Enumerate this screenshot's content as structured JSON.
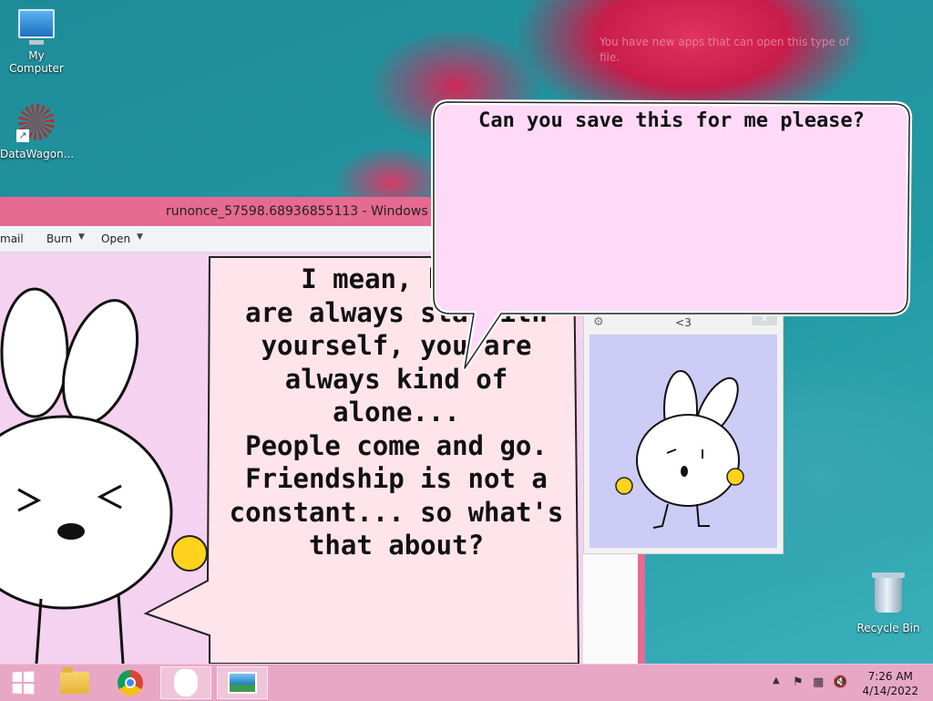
{
  "wallpaper": {
    "notification_hint": "You have new apps that can open this type of file."
  },
  "desktop": {
    "icons": [
      {
        "label": "My Computer"
      },
      {
        "label": "DataWagon..."
      },
      {
        "label": "Recycle Bin"
      }
    ]
  },
  "viewer": {
    "title": "runonce_57598.68936855113 - Windows Photo Viewer",
    "menu": {
      "email": "mail",
      "burn": "Burn",
      "open": "Open"
    },
    "story_lines": [
      "I mean, beca",
      "are always sta     with",
      "yourself, you are",
      "always kind of alone...",
      "People come and go.",
      "Friendship is not a",
      "constant... so what's",
      "that about?"
    ]
  },
  "popup": {
    "message": "Can you save this for me please?"
  },
  "mini_window": {
    "title": "<3"
  },
  "taskbar": {
    "clock_time": "7:26 AM",
    "clock_date": "4/14/2022",
    "tray_chevron": "▲"
  },
  "colors": {
    "taskbar": "#e9a7c6",
    "viewer_frame": "#e66a92",
    "canvas_bg": "#f4d2f0",
    "bubble_bg": "#ffd6f8",
    "mini_canvas": "#ccccf6"
  }
}
